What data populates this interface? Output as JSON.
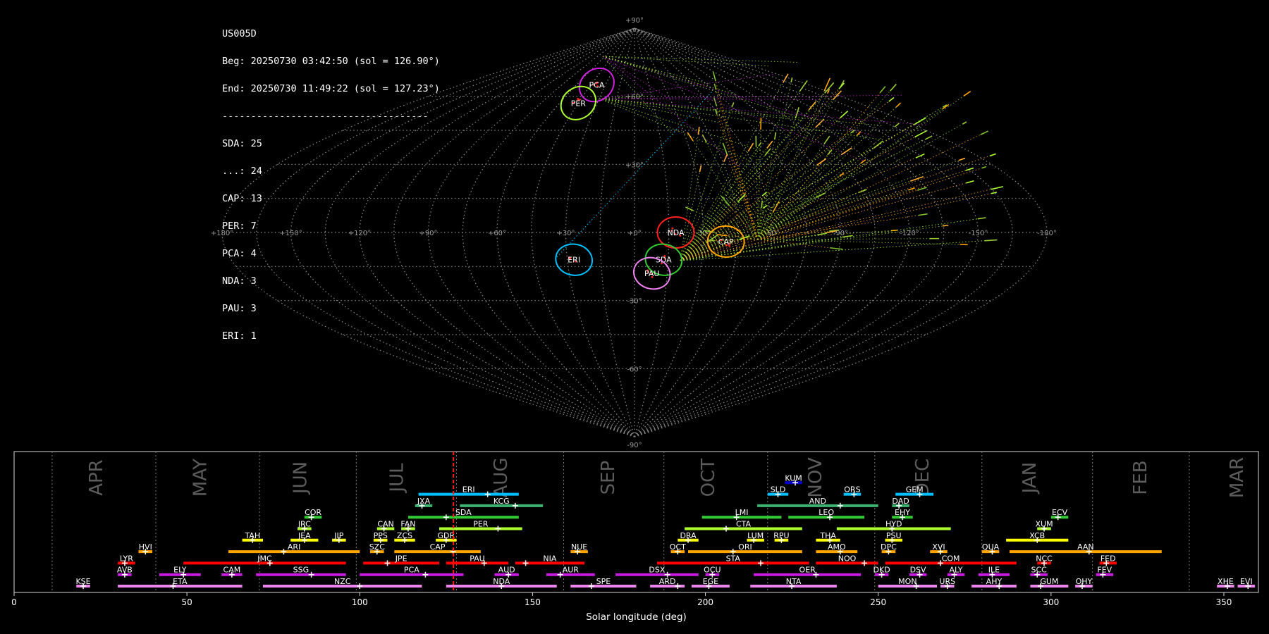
{
  "info": {
    "station": "US005D",
    "beg": "Beg: 20250730 03:42:50 (sol = 126.90°)",
    "end": "End: 20250730 11:49:22 (sol = 127.23°)",
    "separator": "------------------------------------",
    "counts": [
      "SDA: 25",
      "...: 24",
      "CAP: 13",
      "PER: 7",
      "PCA: 4",
      "NDA: 3",
      "PAU: 3",
      "ERI: 1"
    ]
  },
  "sky": {
    "lon_labels": [
      "+180°",
      "+150°",
      "+120°",
      "+90°",
      "+60°",
      "+30°",
      "+0°",
      "-30°",
      "-60°",
      "-90°",
      "-120°",
      "-150°",
      "-180°"
    ],
    "lat_labels": [
      {
        "label": "+90°",
        "lat": 90
      },
      {
        "label": "+60°",
        "lat": 60
      },
      {
        "label": "+30°",
        "lat": 30
      },
      {
        "label": "-30°",
        "lat": -30
      },
      {
        "label": "-60°",
        "lat": -60
      },
      {
        "label": "-90°",
        "lat": -90
      }
    ],
    "radiants": [
      {
        "code": "PCA",
        "color": "#d020e0",
        "lon": 39,
        "lat": 65
      },
      {
        "code": "PER",
        "color": "#adff2f",
        "lon": 45,
        "lat": 57
      },
      {
        "code": "NDA",
        "color": "#ff2020",
        "lon": -18,
        "lat": 0
      },
      {
        "code": "CAP",
        "color": "#ffa500",
        "lon": -40,
        "lat": -4
      },
      {
        "code": "SDA",
        "color": "#32cd32",
        "lon": -13,
        "lat": -12
      },
      {
        "code": "ERI",
        "color": "#00bfff",
        "lon": 27,
        "lat": -12
      },
      {
        "code": "PAU",
        "color": "#ee82ee",
        "lon": -8,
        "lat": -18
      }
    ]
  },
  "chart_data": {
    "type": "timeline",
    "xlabel": "Solar longitude (deg)",
    "xlim": [
      0,
      360
    ],
    "x_ticks": [
      0,
      50,
      100,
      150,
      200,
      250,
      300,
      350
    ],
    "current_sol": 127.1,
    "months": [
      {
        "label": "APR",
        "sol": 24,
        "start": 11
      },
      {
        "label": "MAY",
        "sol": 54,
        "start": 41
      },
      {
        "label": "JUN",
        "sol": 83,
        "start": 71
      },
      {
        "label": "JUL",
        "sol": 111,
        "start": 99
      },
      {
        "label": "AUG",
        "sol": 141,
        "start": 128
      },
      {
        "label": "SEP",
        "sol": 172,
        "start": 159
      },
      {
        "label": "OCT",
        "sol": 201,
        "start": 188
      },
      {
        "label": "NOV",
        "sol": 232,
        "start": 218
      },
      {
        "label": "DEC",
        "sol": 263,
        "start": 249
      },
      {
        "label": "JAN",
        "sol": 294,
        "start": 280
      },
      {
        "label": "FEB",
        "sol": 326,
        "start": 312
      },
      {
        "label": "MAR",
        "sol": 354,
        "start": 340
      }
    ],
    "showers": [
      {
        "code": "KUM",
        "start": 223,
        "end": 228,
        "peak": 226,
        "row": 10,
        "color": "#0000cd"
      },
      {
        "code": "ERI",
        "start": 117,
        "end": 146,
        "peak": 137,
        "row": 9,
        "color": "#00bfff"
      },
      {
        "code": "SLD",
        "start": 218,
        "end": 224,
        "peak": 221,
        "row": 9,
        "color": "#00bfff"
      },
      {
        "code": "ORS",
        "start": 240,
        "end": 245,
        "peak": 243,
        "row": 9,
        "color": "#00bfff"
      },
      {
        "code": "GEM",
        "start": 255,
        "end": 266,
        "peak": 262,
        "row": 9,
        "color": "#00bfff"
      },
      {
        "code": "JXA",
        "start": 116,
        "end": 121,
        "peak": 118,
        "row": 8,
        "color": "#3cb371"
      },
      {
        "code": "KCG",
        "start": 129,
        "end": 153,
        "peak": 145,
        "row": 8,
        "color": "#3cb371"
      },
      {
        "code": "AND",
        "start": 215,
        "end": 250,
        "peak": 239,
        "row": 8,
        "color": "#3cb371"
      },
      {
        "code": "DAD",
        "start": 254,
        "end": 259,
        "peak": 256,
        "row": 8,
        "color": "#3cb371"
      },
      {
        "code": "COR",
        "start": 84,
        "end": 89,
        "peak": 86,
        "row": 7,
        "color": "#32cd32"
      },
      {
        "code": "SDA",
        "start": 114,
        "end": 146,
        "peak": 125,
        "row": 7,
        "color": "#32cd32"
      },
      {
        "code": "LMI",
        "start": 199,
        "end": 222,
        "peak": 209,
        "row": 7,
        "color": "#32cd32"
      },
      {
        "code": "LEO",
        "start": 224,
        "end": 246,
        "peak": 236,
        "row": 7,
        "color": "#32cd32"
      },
      {
        "code": "EHY",
        "start": 254,
        "end": 260,
        "peak": 257,
        "row": 7,
        "color": "#32cd32"
      },
      {
        "code": "ECV",
        "start": 300,
        "end": 305,
        "peak": 302,
        "row": 7,
        "color": "#32cd32"
      },
      {
        "code": "JRC",
        "start": 82,
        "end": 86,
        "peak": 84,
        "row": 6,
        "color": "#adff2f"
      },
      {
        "code": "CAN",
        "start": 105,
        "end": 110,
        "peak": 107,
        "row": 6,
        "color": "#adff2f"
      },
      {
        "code": "FAN",
        "start": 112,
        "end": 116,
        "peak": 114,
        "row": 6,
        "color": "#adff2f"
      },
      {
        "code": "PER",
        "start": 123,
        "end": 147,
        "peak": 140,
        "row": 6,
        "color": "#adff2f"
      },
      {
        "code": "CTA",
        "start": 194,
        "end": 228,
        "peak": 206,
        "row": 6,
        "color": "#adff2f"
      },
      {
        "code": "HYD",
        "start": 238,
        "end": 271,
        "peak": 254,
        "row": 6,
        "color": "#adff2f"
      },
      {
        "code": "XUM",
        "start": 296,
        "end": 300,
        "peak": 298,
        "row": 6,
        "color": "#adff2f"
      },
      {
        "code": "TAH",
        "start": 66,
        "end": 72,
        "peak": 69,
        "row": 5,
        "color": "#ffff00"
      },
      {
        "code": "JEA",
        "start": 80,
        "end": 88,
        "peak": 84,
        "row": 5,
        "color": "#ffff00"
      },
      {
        "code": "JIP",
        "start": 92,
        "end": 96,
        "peak": 94,
        "row": 5,
        "color": "#ffff00"
      },
      {
        "code": "PPS",
        "start": 104,
        "end": 108,
        "peak": 106,
        "row": 5,
        "color": "#ffff00"
      },
      {
        "code": "ZCS",
        "start": 110,
        "end": 116,
        "peak": 113,
        "row": 5,
        "color": "#ffff00"
      },
      {
        "code": "GDR",
        "start": 122,
        "end": 128,
        "peak": 125,
        "row": 5,
        "color": "#ffff00"
      },
      {
        "code": "DRA",
        "start": 192,
        "end": 198,
        "peak": 195,
        "row": 5,
        "color": "#ffff00"
      },
      {
        "code": "LUM",
        "start": 212,
        "end": 217,
        "peak": 214,
        "row": 5,
        "color": "#ffff00"
      },
      {
        "code": "RPU",
        "start": 220,
        "end": 224,
        "peak": 222,
        "row": 5,
        "color": "#ffff00"
      },
      {
        "code": "THA",
        "start": 232,
        "end": 239,
        "peak": 236,
        "row": 5,
        "color": "#ffff00"
      },
      {
        "code": "PSU",
        "start": 252,
        "end": 257,
        "peak": 254,
        "row": 5,
        "color": "#ffff00"
      },
      {
        "code": "XCB",
        "start": 287,
        "end": 305,
        "peak": 296,
        "row": 5,
        "color": "#ffff00"
      },
      {
        "code": "HVI",
        "start": 36,
        "end": 40,
        "peak": 38,
        "row": 4,
        "color": "#ffa500"
      },
      {
        "code": "ARI",
        "start": 62,
        "end": 100,
        "peak": 78,
        "row": 4,
        "color": "#ffa500"
      },
      {
        "code": "SZC",
        "start": 103,
        "end": 107,
        "peak": 105,
        "row": 4,
        "color": "#ffa500"
      },
      {
        "code": "CAP",
        "start": 110,
        "end": 135,
        "peak": 127,
        "row": 4,
        "color": "#ffa500"
      },
      {
        "code": "NUE",
        "start": 161,
        "end": 166,
        "peak": 163,
        "row": 4,
        "color": "#ffa500"
      },
      {
        "code": "OCT",
        "start": 190,
        "end": 194,
        "peak": 192,
        "row": 4,
        "color": "#ffa500"
      },
      {
        "code": "ORI",
        "start": 195,
        "end": 228,
        "peak": 208,
        "row": 4,
        "color": "#ffa500"
      },
      {
        "code": "AMO",
        "start": 232,
        "end": 244,
        "peak": 239,
        "row": 4,
        "color": "#ffa500"
      },
      {
        "code": "DPC",
        "start": 251,
        "end": 255,
        "peak": 253,
        "row": 4,
        "color": "#ffa500"
      },
      {
        "code": "XVI",
        "start": 265,
        "end": 270,
        "peak": 268,
        "row": 4,
        "color": "#ffa500"
      },
      {
        "code": "QUA",
        "start": 280,
        "end": 285,
        "peak": 283,
        "row": 4,
        "color": "#ffa500"
      },
      {
        "code": "AAN",
        "start": 288,
        "end": 332,
        "peak": 311,
        "row": 4,
        "color": "#ffa500"
      },
      {
        "code": "LYR",
        "start": 30,
        "end": 35,
        "peak": 32,
        "row": 3,
        "color": "#ff0000"
      },
      {
        "code": "JMC",
        "start": 49,
        "end": 96,
        "peak": 74,
        "row": 3,
        "color": "#ff0000"
      },
      {
        "code": "JPE",
        "start": 101,
        "end": 123,
        "peak": 108,
        "row": 3,
        "color": "#ff0000"
      },
      {
        "code": "PAU",
        "start": 125,
        "end": 143,
        "peak": 136,
        "row": 3,
        "color": "#ff0000"
      },
      {
        "code": "NIA",
        "start": 145,
        "end": 165,
        "peak": 148,
        "row": 3,
        "color": "#ff0000"
      },
      {
        "code": "STA",
        "start": 186,
        "end": 230,
        "peak": 216,
        "row": 3,
        "color": "#ff0000"
      },
      {
        "code": "NOO",
        "start": 232,
        "end": 250,
        "peak": 246,
        "row": 3,
        "color": "#ff0000"
      },
      {
        "code": "COM",
        "start": 252,
        "end": 290,
        "peak": 268,
        "row": 3,
        "color": "#ff0000"
      },
      {
        "code": "NCC",
        "start": 296,
        "end": 300,
        "peak": 298,
        "row": 3,
        "color": "#ff0000"
      },
      {
        "code": "FED",
        "start": 314,
        "end": 319,
        "peak": 316,
        "row": 3,
        "color": "#ff0000"
      },
      {
        "code": "AVB",
        "start": 30,
        "end": 34,
        "peak": 32,
        "row": 2,
        "color": "#c71ce0"
      },
      {
        "code": "ELY",
        "start": 42,
        "end": 54,
        "peak": 49,
        "row": 2,
        "color": "#c71ce0"
      },
      {
        "code": "CAM",
        "start": 60,
        "end": 66,
        "peak": 63,
        "row": 2,
        "color": "#c71ce0"
      },
      {
        "code": "SSG",
        "start": 70,
        "end": 96,
        "peak": 86,
        "row": 2,
        "color": "#c71ce0"
      },
      {
        "code": "PCA",
        "start": 100,
        "end": 130,
        "peak": 119,
        "row": 2,
        "color": "#c71ce0"
      },
      {
        "code": "AUD",
        "start": 139,
        "end": 146,
        "peak": 143,
        "row": 2,
        "color": "#c71ce0"
      },
      {
        "code": "AUR",
        "start": 154,
        "end": 168,
        "peak": 158,
        "row": 2,
        "color": "#c71ce0"
      },
      {
        "code": "DSX",
        "start": 174,
        "end": 198,
        "peak": 189,
        "row": 2,
        "color": "#c71ce0"
      },
      {
        "code": "OCU",
        "start": 200,
        "end": 204,
        "peak": 202,
        "row": 2,
        "color": "#c71ce0"
      },
      {
        "code": "OER",
        "start": 214,
        "end": 245,
        "peak": 232,
        "row": 2,
        "color": "#c71ce0"
      },
      {
        "code": "DKD",
        "start": 249,
        "end": 253,
        "peak": 251,
        "row": 2,
        "color": "#c71ce0"
      },
      {
        "code": "DSV",
        "start": 259,
        "end": 264,
        "peak": 262,
        "row": 2,
        "color": "#c71ce0"
      },
      {
        "code": "ALY",
        "start": 270,
        "end": 275,
        "peak": 272,
        "row": 2,
        "color": "#c71ce0"
      },
      {
        "code": "ILE",
        "start": 279,
        "end": 288,
        "peak": 283,
        "row": 2,
        "color": "#c71ce0"
      },
      {
        "code": "SCC",
        "start": 294,
        "end": 299,
        "peak": 296,
        "row": 2,
        "color": "#c71ce0"
      },
      {
        "code": "FEV",
        "start": 313,
        "end": 318,
        "peak": 315,
        "row": 2,
        "color": "#c71ce0"
      },
      {
        "code": "KSE",
        "start": 18,
        "end": 22,
        "peak": 20,
        "row": 1,
        "color": "#ee82ee"
      },
      {
        "code": "ETA",
        "start": 30,
        "end": 66,
        "peak": 46,
        "row": 1,
        "color": "#ee82ee"
      },
      {
        "code": "NZC",
        "start": 72,
        "end": 118,
        "peak": 100,
        "row": 1,
        "color": "#ee82ee"
      },
      {
        "code": "NDA",
        "start": 125,
        "end": 157,
        "peak": 141,
        "row": 1,
        "color": "#ee82ee"
      },
      {
        "code": "SPE",
        "start": 161,
        "end": 180,
        "peak": 167,
        "row": 1,
        "color": "#ee82ee"
      },
      {
        "code": "ARD",
        "start": 184,
        "end": 194,
        "peak": 192,
        "row": 1,
        "color": "#ee82ee"
      },
      {
        "code": "EGE",
        "start": 196,
        "end": 207,
        "peak": 201,
        "row": 1,
        "color": "#ee82ee"
      },
      {
        "code": "NTA",
        "start": 213,
        "end": 238,
        "peak": 225,
        "row": 1,
        "color": "#ee82ee"
      },
      {
        "code": "MON",
        "start": 250,
        "end": 267,
        "peak": 261,
        "row": 1,
        "color": "#ee82ee"
      },
      {
        "code": "URS",
        "start": 268,
        "end": 272,
        "peak": 270,
        "row": 1,
        "color": "#ee82ee"
      },
      {
        "code": "AHY",
        "start": 277,
        "end": 290,
        "peak": 285,
        "row": 1,
        "color": "#ee82ee"
      },
      {
        "code": "GUM",
        "start": 294,
        "end": 305,
        "peak": 297,
        "row": 1,
        "color": "#ee82ee"
      },
      {
        "code": "OHY",
        "start": 307,
        "end": 312,
        "peak": 309,
        "row": 1,
        "color": "#ee82ee"
      },
      {
        "code": "XHE",
        "start": 348,
        "end": 353,
        "peak": 351,
        "row": 1,
        "color": "#ee82ee"
      },
      {
        "code": "EVI",
        "start": 354,
        "end": 359,
        "peak": 357,
        "row": 1,
        "color": "#ee82ee"
      }
    ]
  }
}
